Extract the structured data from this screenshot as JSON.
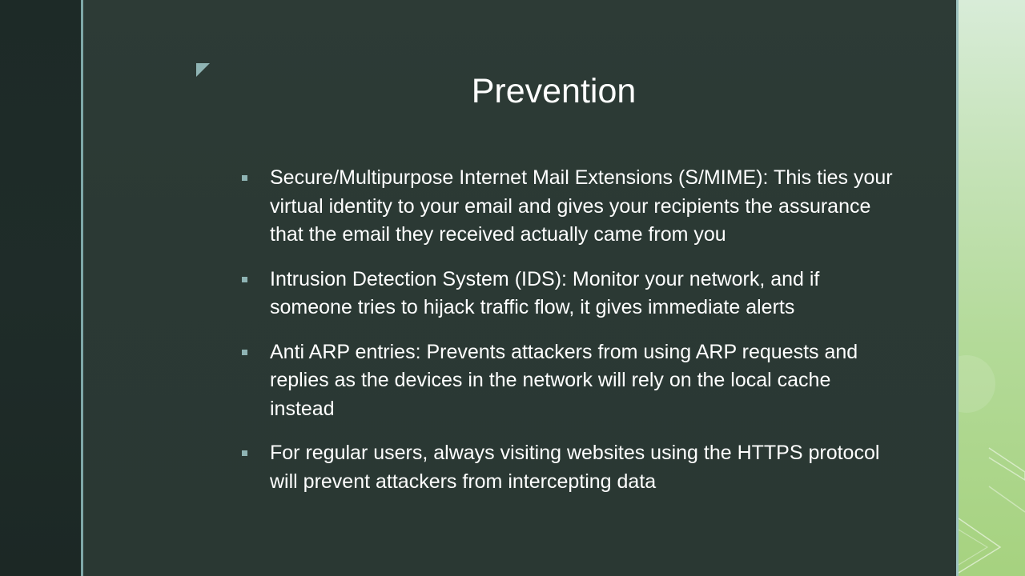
{
  "slide": {
    "title": "Prevention",
    "bullets": [
      "Secure/Multipurpose Internet Mail Extensions (S/MIME): This ties your virtual identity to your email and gives your recipients the assurance that the email they received actually came from you",
      "Intrusion Detection System (IDS): Monitor your network, and if someone tries to hijack traffic flow, it gives immediate alerts",
      "Anti ARP entries: Prevents attackers from using ARP requests and replies as the devices in the network will rely on the local cache instead",
      "For regular users, always visiting websites using the HTTPS protocol will prevent attackers from intercepting data"
    ],
    "bullet_icon": "square-bullet-icon",
    "colors": {
      "background": "#2b3934",
      "text": "#ffffff",
      "accent": "#8fb4b4",
      "side_panel_green": "#b3da98"
    }
  }
}
